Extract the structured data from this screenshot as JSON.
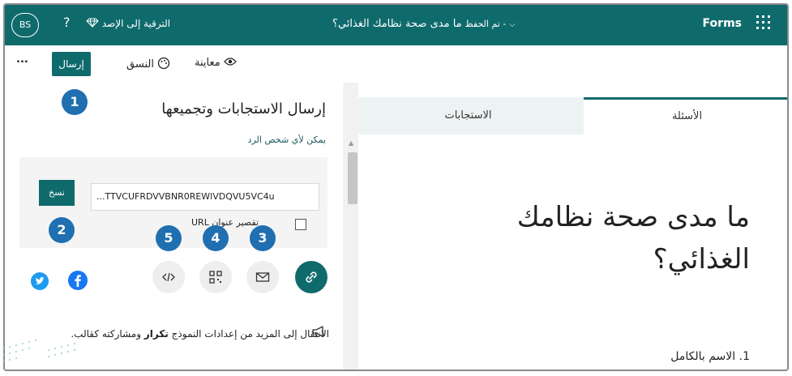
{
  "topbar": {
    "avatar": "BS",
    "help": "?",
    "upgrade": "الترقية إلى الإصد",
    "doc_title": "ما مدى صحة نظامك الغذائي؟",
    "save_status": "- تم الحفظ",
    "app_name": "Forms"
  },
  "toolbar": {
    "more": "...",
    "send": "إرسال",
    "style": "النسق",
    "preview": "معاينة"
  },
  "send_panel": {
    "title": "إرسال الاستجابات وتجميعها",
    "subtitle": "يمكن لأي شخص الرد",
    "url": "...TTVCUFRDVVBNR0REWlVDQVU5VC4u",
    "copy": "نسخ",
    "shorten": "تقصير عنوان URL",
    "tip_before": "الانتقال إلى المزيد من إعدادات النموذج",
    "tip_bold": "تكرار",
    "tip_after": "ومشاركته كقالب."
  },
  "share_methods": [
    "link-icon",
    "email-icon",
    "qr-code-icon",
    "embed-icon"
  ],
  "badges": [
    "1",
    "2",
    "3",
    "4",
    "5"
  ],
  "tabs": {
    "questions": "الأسئلة",
    "responses": "الاستجابات"
  },
  "form": {
    "title": "ما مدى صحة نظامك الغذائي؟",
    "q1_number": "1.",
    "q1_label": "الاسم بالكامل"
  },
  "colors": {
    "brand": "#0f6a6c",
    "badge": "#1f6fb1",
    "twitter": "#1d9bf0",
    "facebook": "#1877f2"
  }
}
